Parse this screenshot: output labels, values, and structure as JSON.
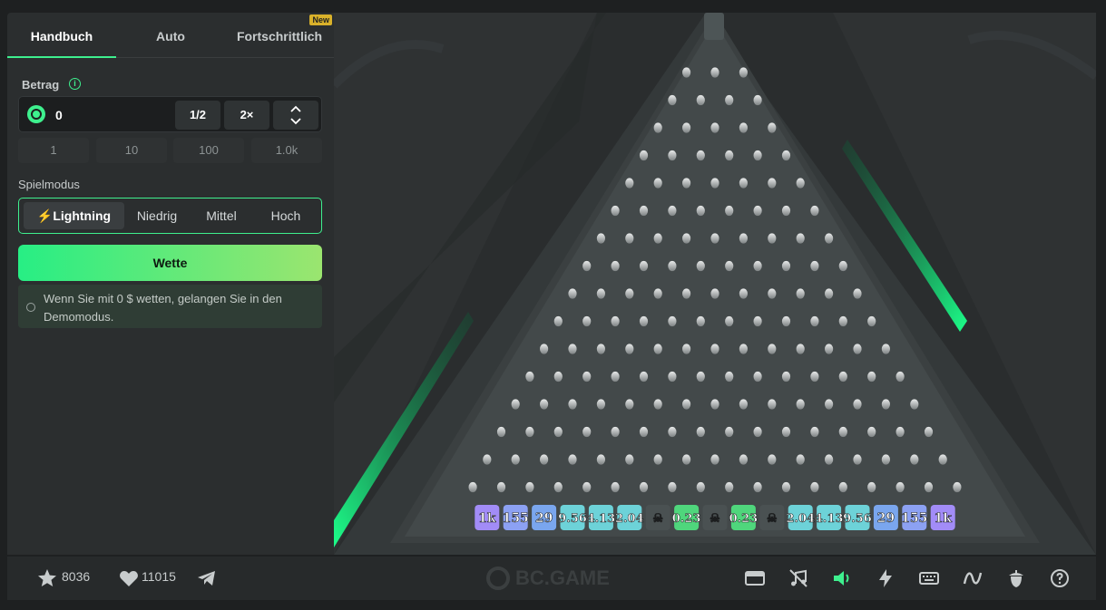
{
  "tabs": [
    {
      "label": "Handbuch",
      "active": true
    },
    {
      "label": "Auto",
      "active": false
    },
    {
      "label": "Fortschrittlich",
      "active": false
    }
  ],
  "new_badge": "New",
  "amount": {
    "label": "Betrag",
    "value": "0",
    "half_label": "1/2",
    "double_label": "2×"
  },
  "quick_amounts": [
    "1",
    "10",
    "100",
    "1.0k"
  ],
  "game_mode": {
    "label": "Spielmodus",
    "options": [
      "Lightning",
      "Niedrig",
      "Mittel",
      "Hoch"
    ],
    "selected": "Lightning"
  },
  "bet_button": "Wette",
  "notice": "Wenn Sie mit 0 $ wetten, gelangen Sie in den Demomodus.",
  "board": {
    "rows": 16,
    "multipliers": [
      "1k",
      "155",
      "29",
      "9.56",
      "4.13",
      "2.04",
      "skull",
      "0.23",
      "skull",
      "0.23",
      "skull",
      "2.04",
      "4.13",
      "9.56",
      "29",
      "155",
      "1k"
    ]
  },
  "footer": {
    "favorites": "8036",
    "likes": "11015",
    "brand": "BC.GAME",
    "accent": "#3ef08e",
    "icons": [
      "theater-mode-icon",
      "music-off-icon",
      "sound-icon",
      "lightning-icon",
      "keyboard-icon",
      "fairness-chart-icon",
      "acorn-icon",
      "help-icon"
    ]
  },
  "colors": {
    "accent": "#3ef08e",
    "panel": "#2b2e2f",
    "board": "#2a2d2e"
  }
}
